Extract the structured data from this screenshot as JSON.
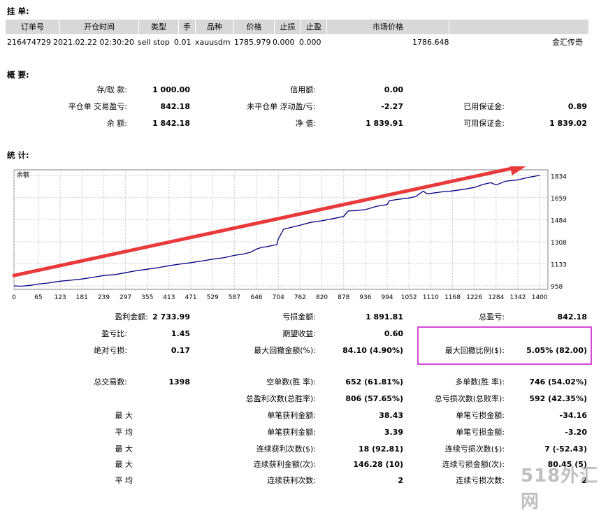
{
  "orders": {
    "title": "挂 单:",
    "columns": [
      "订单号",
      "开仓时间",
      "类型",
      "手",
      "品种",
      "价格",
      "止损",
      "止盈",
      "市场价格",
      ""
    ],
    "row": {
      "ticket": "216474729",
      "time": "2021.02.22 02:30:20",
      "type": "sell stop",
      "lots": "0.01",
      "symbol": "xauusdm",
      "price": "1785.979",
      "sl": "0.000",
      "tp": "0.000",
      "market_price": "1786.648",
      "comment": "金汇传奇"
    }
  },
  "summary": {
    "title": "概 要:",
    "deposit_label": "存/取 款:",
    "deposit": "1 000.00",
    "credit_label": "信用额:",
    "credit": "0.00",
    "closed_pl_label": "平仓单 交易盈亏:",
    "closed_pl": "842.18",
    "floating_pl_label": "未平仓单 浮动盈/亏:",
    "floating_pl": "-2.27",
    "margin_label": "已用保证金:",
    "margin": "0.89",
    "balance_label": "余 额:",
    "balance": "1 842.18",
    "equity_label": "净 值:",
    "equity": "1 839.91",
    "free_margin_label": "可用保证金:",
    "free_margin": "1 839.02"
  },
  "stats": {
    "title": "统 计:",
    "gross_profit_label": "盈利金额:",
    "gross_profit": "2 733.99",
    "gross_loss_label": "亏损金额:",
    "gross_loss": "1 891.81",
    "total_net_label": "总盈亏:",
    "total_net": "842.18",
    "profit_factor_label": "盈亏比:",
    "profit_factor": "1.45",
    "expected_label": "期望收益:",
    "expected": "0.60",
    "abs_dd_label": "绝对亏损:",
    "abs_dd": "0.17",
    "max_dd_label": "最大回撤金额(%):",
    "max_dd": "84.10 (4.90%)",
    "max_dd_pct_label": "最大回撤比例($):",
    "max_dd_pct": "5.05% (82.00)",
    "total_trades_label": "总交易数:",
    "total_trades": "1398",
    "short_label": "空单数(胜 率):",
    "short": "652 (61.81%)",
    "long_label": "多单数(胜 率):",
    "long": "746 (54.02%)",
    "win_count_label": "总盈利次数(总胜率):",
    "win_count": "806 (57.65%)",
    "loss_count_label": "总亏损次数(总败率):",
    "loss_count": "592 (42.35%)",
    "max_label": "最 大",
    "largest_win_label": "单笔获利金额:",
    "largest_win": "38.43",
    "largest_loss_label": "单笔亏损金额:",
    "largest_loss": "-34.16",
    "avg_label": "平 均",
    "avg_win_label": "单笔获利金额:",
    "avg_win": "3.39",
    "avg_loss_label": "单笔亏损金额:",
    "avg_loss": "-3.20",
    "max2_label": "最 大",
    "max_cons_wins_label": "连续获利次数($):",
    "max_cons_wins": "18 (92.81)",
    "max_cons_losses_label": "连续亏损次数($):",
    "max_cons_losses": "7 (-52.43)",
    "max3_label": "最 大",
    "max_cons_profit_label": "连续获利金额(次):",
    "max_cons_profit": "146.28 (10)",
    "max_cons_loss_label": "连续亏损金额(次):",
    "max_cons_loss": "80.45 (5)",
    "avg2_label": "平 均",
    "avg_cons_wins_label": "连续获利次数:",
    "avg_cons_wins": "2",
    "avg_cons_losses_label": "连续亏损次数:",
    "avg_cons_losses": "2"
  },
  "chart_data": {
    "type": "line",
    "title": "余额",
    "x_ticks": [
      0,
      65,
      123,
      181,
      239,
      297,
      355,
      413,
      471,
      529,
      587,
      646,
      704,
      762,
      820,
      878,
      936,
      994,
      1052,
      1110,
      1168,
      1226,
      1284,
      1342,
      1400
    ],
    "y_ticks": [
      958,
      1133,
      1308,
      1484,
      1659,
      1834
    ],
    "xlim": [
      0,
      1422
    ],
    "ylim": [
      930,
      1880
    ],
    "series": [
      {
        "color": "#000080",
        "x": [
          0,
          20,
          45,
          65,
          90,
          123,
          150,
          181,
          210,
          239,
          270,
          297,
          320,
          355,
          385,
          413,
          440,
          471,
          500,
          529,
          560,
          587,
          610,
          630,
          646,
          660,
          675,
          690,
          700,
          704,
          718,
          735,
          762,
          790,
          820,
          850,
          878,
          890,
          910,
          936,
          965,
          994,
          1000,
          1020,
          1052,
          1070,
          1090,
          1100,
          1110,
          1140,
          1168,
          1200,
          1226,
          1250,
          1270,
          1284,
          1310,
          1342,
          1370,
          1400
        ],
        "y": [
          958,
          955,
          962,
          972,
          980,
          995,
          1002,
          1012,
          1025,
          1040,
          1048,
          1062,
          1075,
          1090,
          1103,
          1118,
          1130,
          1142,
          1155,
          1170,
          1182,
          1200,
          1210,
          1225,
          1250,
          1264,
          1270,
          1280,
          1285,
          1330,
          1408,
          1420,
          1440,
          1462,
          1475,
          1492,
          1510,
          1553,
          1556,
          1564,
          1590,
          1604,
          1635,
          1644,
          1656,
          1668,
          1710,
          1690,
          1693,
          1705,
          1712,
          1726,
          1740,
          1765,
          1778,
          1760,
          1790,
          1800,
          1820,
          1836
        ]
      }
    ],
    "annotation": {
      "type": "arrow",
      "color": "#e83a3a",
      "from": {
        "x": 0,
        "y": 1040
      },
      "to": {
        "x": 1370,
        "y": 1920
      }
    }
  },
  "watermark": "518外汇网"
}
